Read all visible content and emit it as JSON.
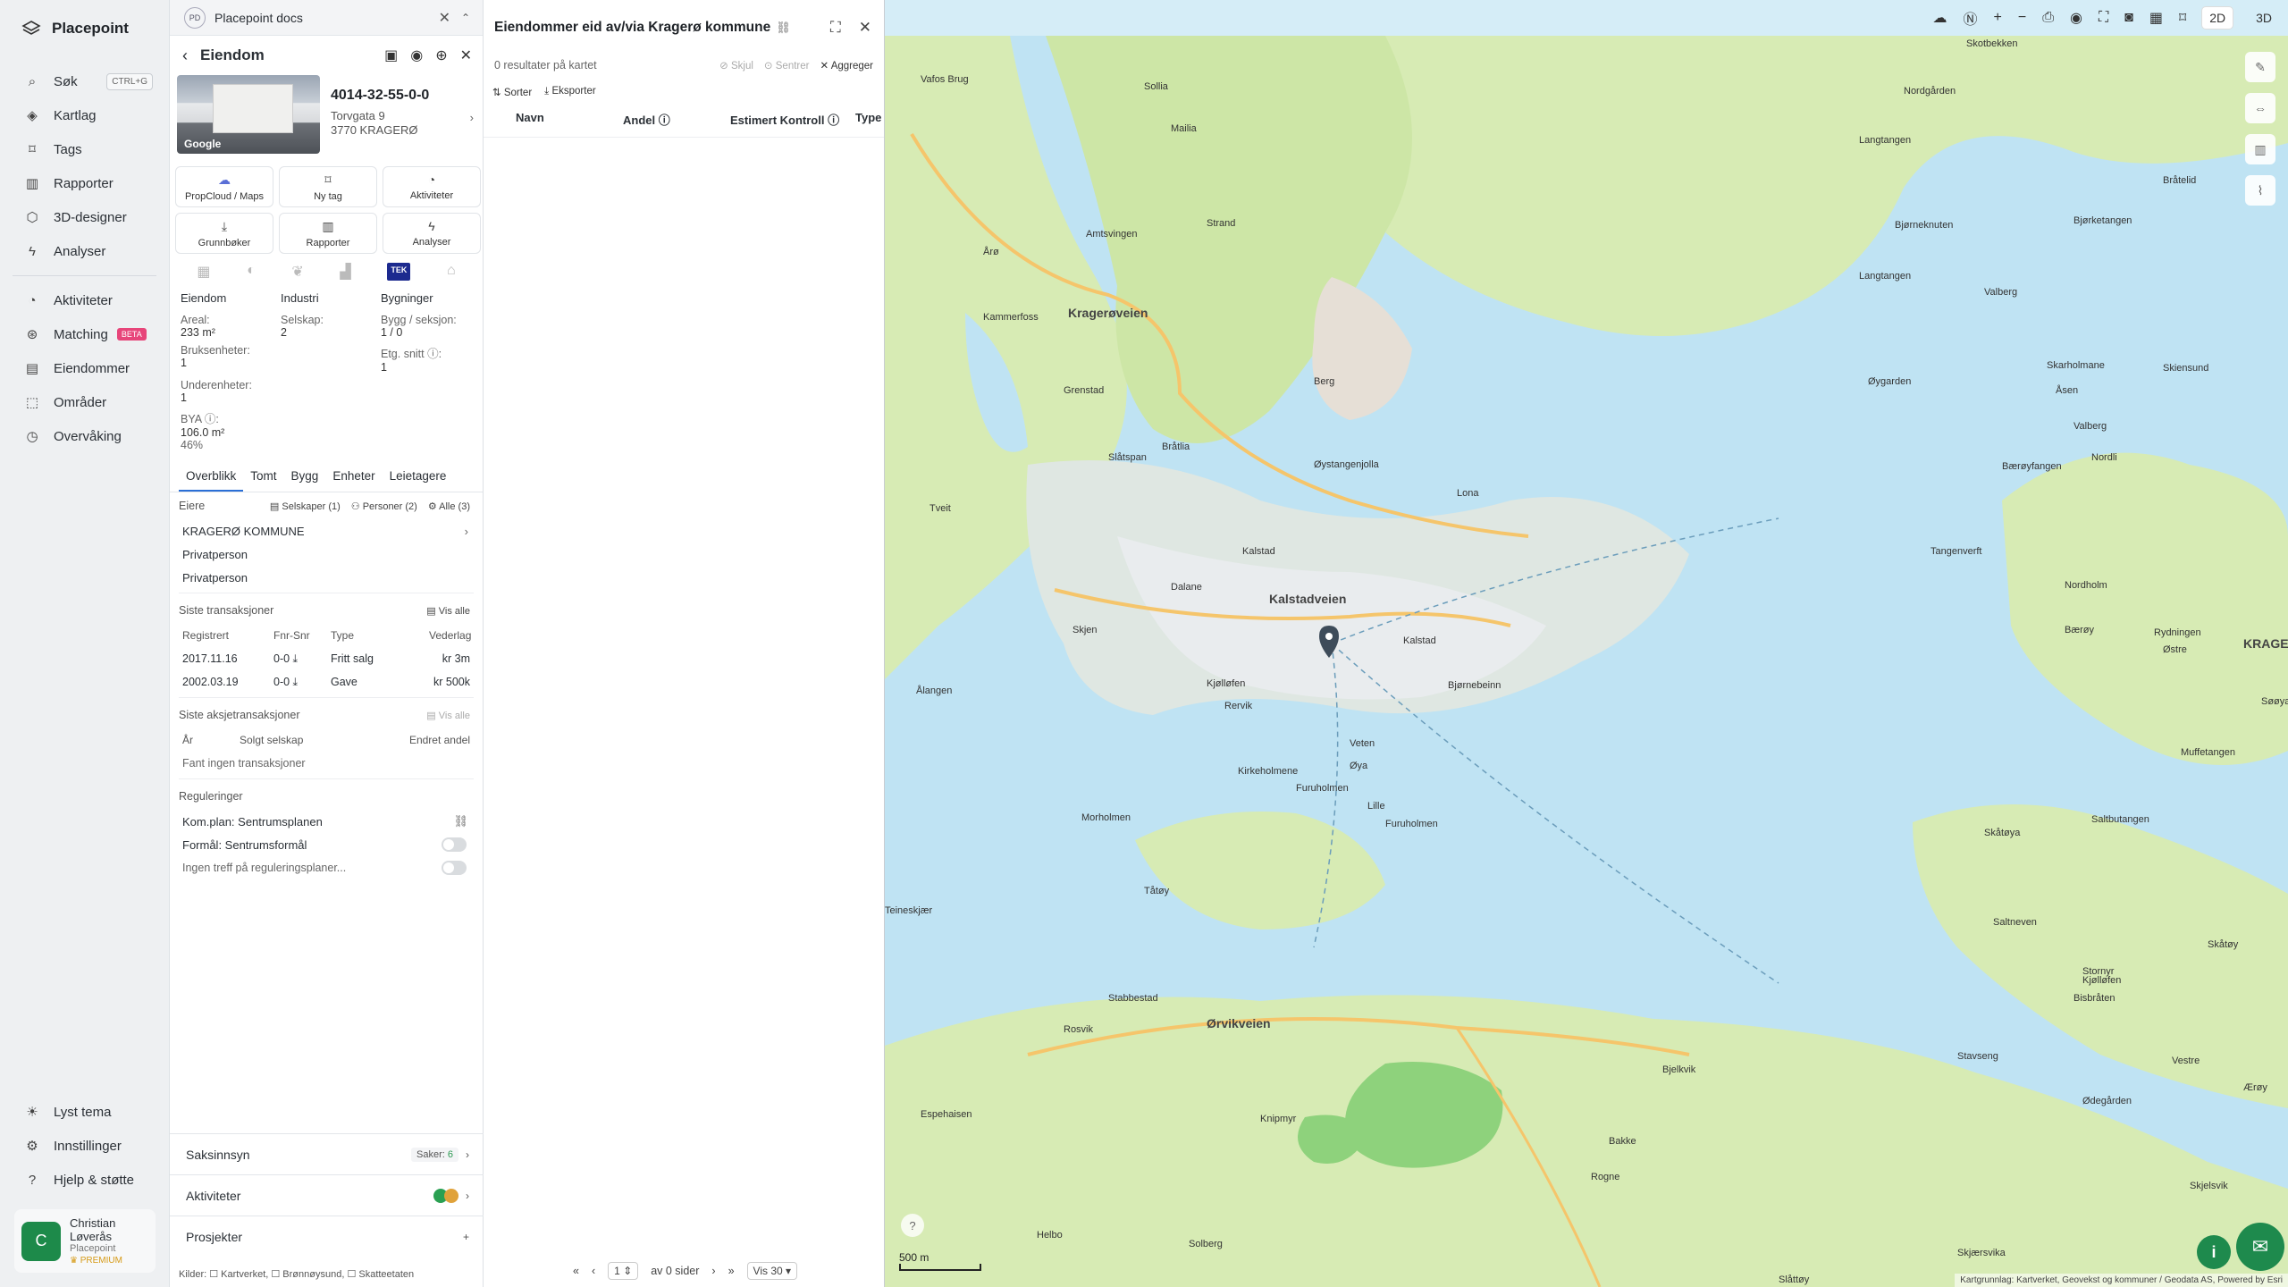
{
  "brand": {
    "name": "Placepoint"
  },
  "nav": {
    "items": [
      {
        "label": "Søk",
        "shortcut": "CTRL+G"
      },
      {
        "label": "Kartlag"
      },
      {
        "label": "Tags"
      },
      {
        "label": "Rapporter"
      },
      {
        "label": "3D-designer"
      },
      {
        "label": "Analyser"
      },
      {
        "label": "Aktiviteter"
      },
      {
        "label": "Matching",
        "badge": "BETA"
      },
      {
        "label": "Eiendommer"
      },
      {
        "label": "Områder"
      },
      {
        "label": "Overvåking"
      }
    ],
    "bottom": [
      {
        "label": "Lyst tema"
      },
      {
        "label": "Innstillinger"
      },
      {
        "label": "Hjelp & støtte"
      }
    ],
    "user": {
      "initial": "C",
      "name": "Christian Løverås",
      "org": "Placepoint",
      "plan": "PREMIUM"
    }
  },
  "doc": {
    "logo": "PD",
    "title": "Placepoint docs"
  },
  "property": {
    "header": "Eiendom",
    "id": "4014-32-55-0-0",
    "street": "Torvgata 9",
    "city": "3770 KRAGERØ",
    "photo_credit": "Google",
    "buttons": [
      "PropCloud / Maps",
      "Ny tag",
      "Aktiviteter",
      "Grunnbøker",
      "Rapporter",
      "Analyser"
    ],
    "tek": "TEK",
    "facts": {
      "col1_head": "Eiendom",
      "col2_head": "Industri",
      "col3_head": "Bygninger",
      "areal_label": "Areal:",
      "areal_value": "233 m²",
      "selskap_label": "Selskap:",
      "selskap_value": "2",
      "bygg_label": "Bygg / seksjon:",
      "bygg_value": "1 / 0",
      "bruks_label": "Bruksenheter:",
      "bruks_value": "1",
      "etg_label": "Etg. snitt ⓘ:",
      "etg_value": "1",
      "under_label": "Underenheter:",
      "under_value": "1",
      "bya_label": "BYA ⓘ:",
      "bya_value": "106.0 m²",
      "bya_pct": "46%"
    },
    "tabs": [
      "Overblikk",
      "Tomt",
      "Bygg",
      "Enheter",
      "Leietagere"
    ],
    "owners": {
      "title": "Eiere",
      "filters": [
        "Selskaper (1)",
        "Personer (2)",
        "Alle (3)"
      ],
      "list": [
        "KRAGERØ KOMMUNE",
        "Privatperson",
        "Privatperson"
      ]
    },
    "transactions": {
      "title": "Siste transaksjoner",
      "view_all": "Vis alle",
      "headers": [
        "Registrert",
        "Fnr-Snr",
        "Type",
        "Vederlag"
      ],
      "rows": [
        [
          "2017.11.16",
          "0-0",
          "Fritt salg",
          "kr 3m"
        ],
        [
          "2002.03.19",
          "0-0",
          "Gave",
          "kr 500k"
        ]
      ]
    },
    "share_tx": {
      "title": "Siste aksjetransaksjoner",
      "view_all": "Vis alle",
      "headers": [
        "År",
        "Solgt selskap",
        "Endret andel"
      ],
      "empty": "Fant ingen transaksjoner"
    },
    "regulations": {
      "title": "Reguleringer",
      "items": [
        "Kom.plan: Sentrumsplanen",
        "Formål: Sentrumsformål",
        "Ingen treff på reguleringsplaner..."
      ]
    },
    "accordions": [
      {
        "label": "Saksinnsyn",
        "extra": "Saker:",
        "count": "6"
      },
      {
        "label": "Aktiviteter"
      },
      {
        "label": "Prosjekter"
      }
    ],
    "sources": "Kilder: ☐ Kartverket, ☐ Brønnøysund, ☐ Skatteetaten"
  },
  "list": {
    "title": "Eiendommer eid av/via Kragerø kommune",
    "results": "0 resultater på kartet",
    "actions": [
      "Skjul",
      "Sentrer",
      "Aggreger"
    ],
    "tools": [
      "Sorter",
      "Eksporter"
    ],
    "columns": [
      "Navn",
      "Andel ⓘ",
      "Estimert Kontroll ⓘ",
      "Type"
    ],
    "pager": {
      "page": "1",
      "of": "av 0 sider",
      "per": "Vis 30"
    }
  },
  "map": {
    "modes": [
      "2D",
      "3D"
    ],
    "scale": "500 m",
    "attribution": "Kartgrunnlag: Kartverket, Geovekst og kommuner / Geodata AS, Powered by Esri",
    "labels": [
      "Skotbekken",
      "Vafos Brug",
      "Sollia",
      "Nordgården",
      "Mailia",
      "Langtangen",
      "Bjørketangen",
      "Bråtelid",
      "Strand",
      "Bjørneknuten",
      "Valberg",
      "Amtsvingen",
      "Langtangen",
      "Årø",
      "Kammerfoss",
      "Kragerøveien",
      "Skarholmane",
      "Skiensund",
      "Berg",
      "Øygarden",
      "Åsen",
      "Grenstad",
      "Valberg",
      "Bråtlia",
      "Øystangenjolla",
      "Slåtspan",
      "Nordli",
      "Bærøyfangen",
      "Tveit",
      "Kalstad",
      "Tangenverft",
      "Lona",
      "Dalane",
      "Kalstadveien",
      "Kalstad",
      "Nordholm",
      "Bærøy",
      "Skjen",
      "Bjørnebeinn",
      "KRAGERØ",
      "Rydningen",
      "Østre",
      "Kjølløfen",
      "Rervik",
      "Ålangen",
      "Kirkeholmene",
      "Veten",
      "Øya",
      "Muffetangen",
      "Søøya",
      "Furuholmen",
      "Lille",
      "Furuholmen",
      "Morholmen",
      "Skåtøya",
      "Saltbutangen",
      "Tåtøy",
      "Teineskjær",
      "Saltneven",
      "Stabbestad",
      "Bisbråten",
      "Stornyr",
      "Skåtøy",
      "Rosvik",
      "Ørvikveien",
      "Kjølløfen",
      "Stavseng",
      "Vestre",
      "Ærøy",
      "Bjelkvik",
      "Ødegården",
      "Espehaisen",
      "Knipmyr",
      "Bakke",
      "Rogne",
      "Skjelsvik",
      "Helbo",
      "Solberg",
      "Skjærsvika",
      "Slåttøy"
    ]
  }
}
